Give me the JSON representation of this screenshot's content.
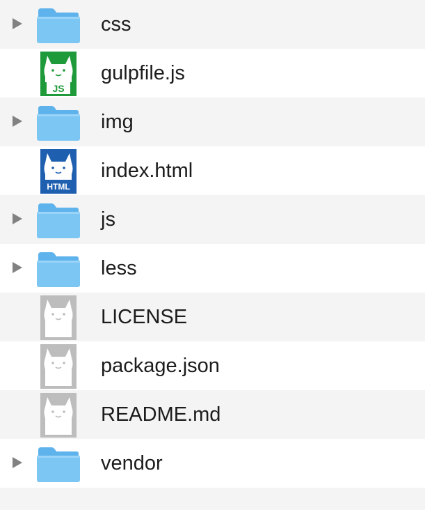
{
  "items": [
    {
      "name": "css",
      "kind": "folder",
      "expandable": true
    },
    {
      "name": "gulpfile.js",
      "kind": "file",
      "badge": "JS",
      "badge_color": "#1f9a3a"
    },
    {
      "name": "img",
      "kind": "folder",
      "expandable": true
    },
    {
      "name": "index.html",
      "kind": "file",
      "badge": "HTML",
      "badge_color": "#1e5fb0"
    },
    {
      "name": "js",
      "kind": "folder",
      "expandable": true
    },
    {
      "name": "less",
      "kind": "folder",
      "expandable": true
    },
    {
      "name": "LICENSE",
      "kind": "file-generic"
    },
    {
      "name": "package.json",
      "kind": "file-generic"
    },
    {
      "name": "README.md",
      "kind": "file-generic"
    },
    {
      "name": "vendor",
      "kind": "folder",
      "expandable": true
    }
  ],
  "colors": {
    "folder": "#7cc6f4",
    "folder_tab": "#5fb3ec",
    "generic_file": "#bdbdbd",
    "stripe": "#f4f4f4",
    "disclosure": "#818181"
  }
}
